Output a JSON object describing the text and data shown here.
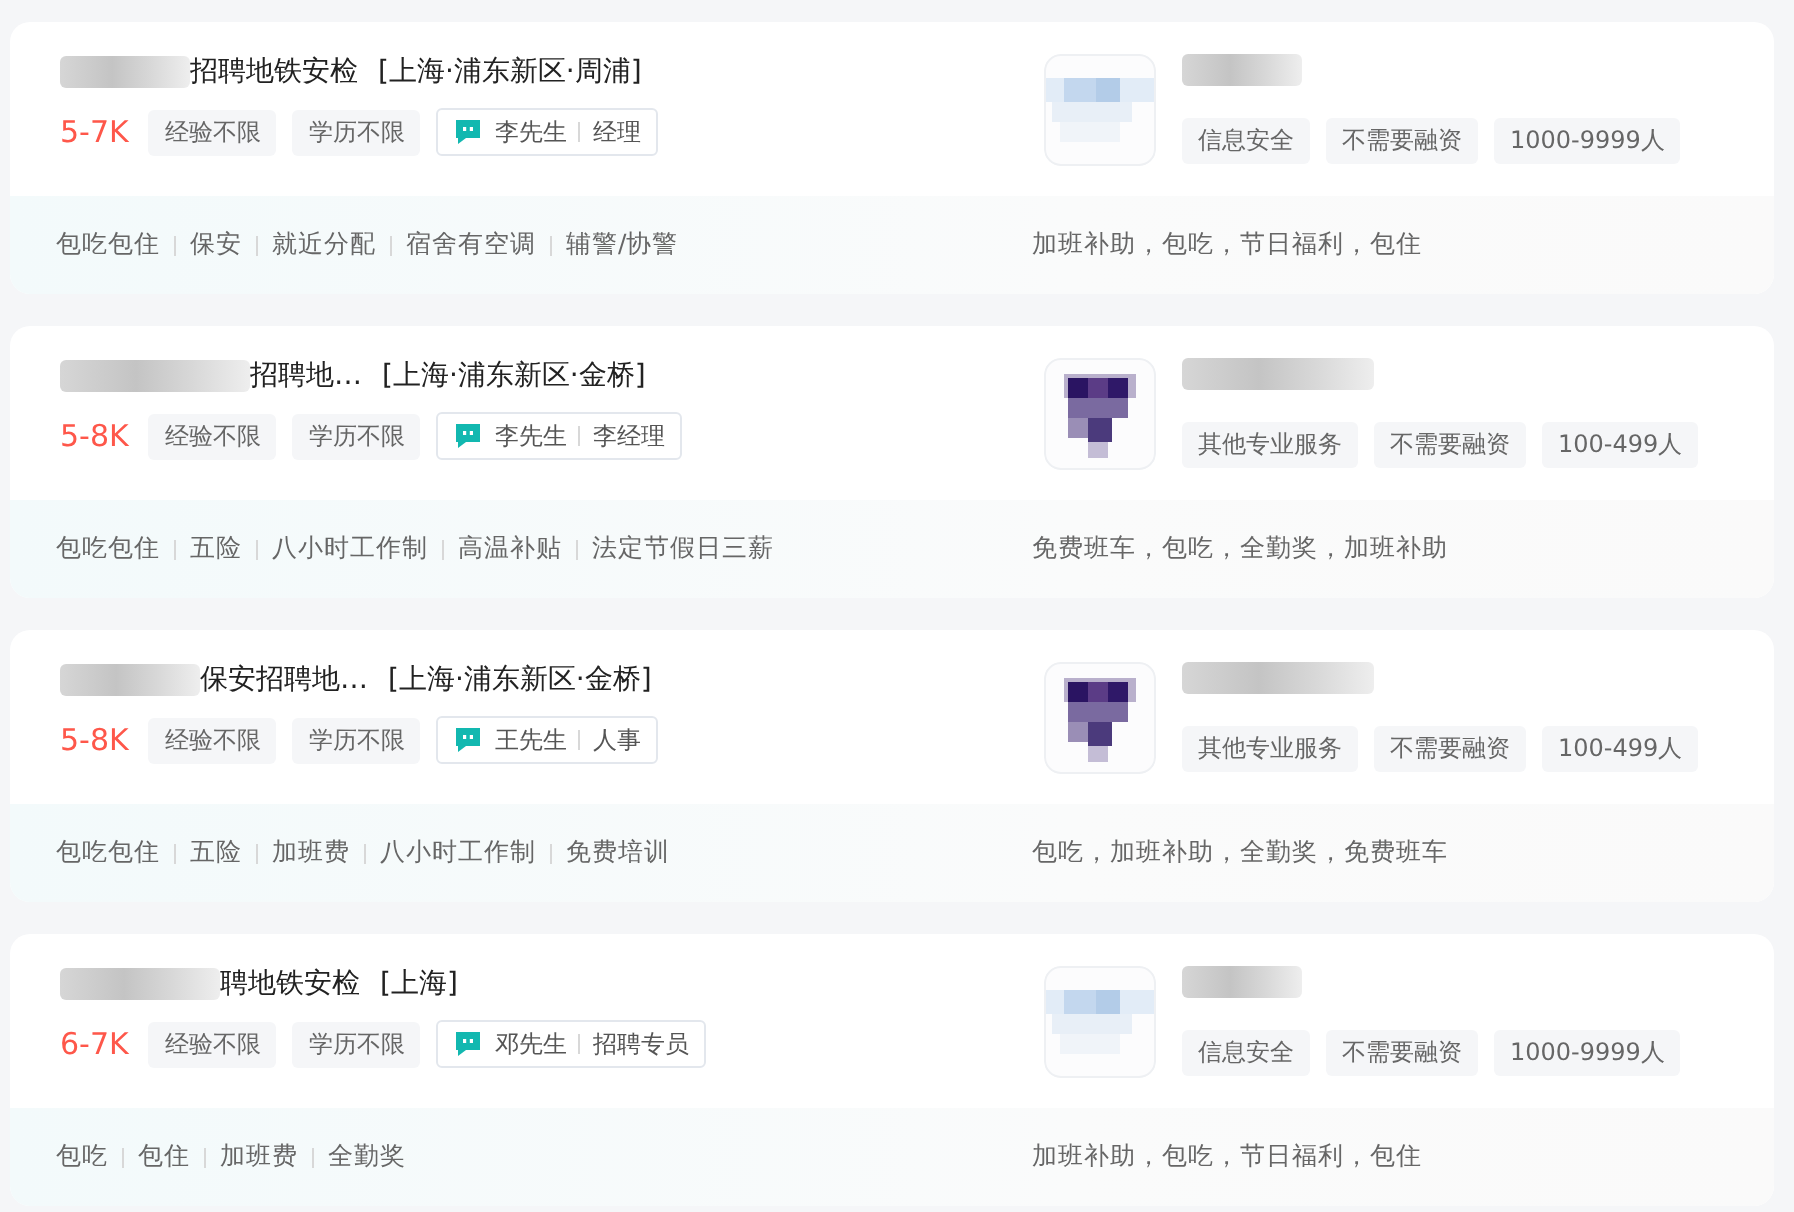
{
  "jobs": [
    {
      "title": "招聘地铁安检",
      "location": "[上海·浦东新区·周浦]",
      "salary": "5-7K",
      "requirements": [
        "经验不限",
        "学历不限"
      ],
      "recruiter": {
        "name": "李先生",
        "role": "经理"
      },
      "company_tags": [
        "信息安全",
        "不需要融资",
        "1000-9999人"
      ],
      "job_tags": [
        "包吃包住",
        "保安",
        "就近分配",
        "宿舍有空调",
        "辅警/协警"
      ],
      "benefits": "加班补助，包吃，节日福利，包住"
    },
    {
      "title": "招聘地…",
      "location": "[上海·浦东新区·金桥]",
      "salary": "5-8K",
      "requirements": [
        "经验不限",
        "学历不限"
      ],
      "recruiter": {
        "name": "李先生",
        "role": "李经理"
      },
      "company_tags": [
        "其他专业服务",
        "不需要融资",
        "100-499人"
      ],
      "job_tags": [
        "包吃包住",
        "五险",
        "八小时工作制",
        "高温补贴",
        "法定节假日三薪"
      ],
      "benefits": "免费班车，包吃，全勤奖，加班补助"
    },
    {
      "title": "保安招聘地…",
      "location": "[上海·浦东新区·金桥]",
      "salary": "5-8K",
      "requirements": [
        "经验不限",
        "学历不限"
      ],
      "recruiter": {
        "name": "王先生",
        "role": "人事"
      },
      "company_tags": [
        "其他专业服务",
        "不需要融资",
        "100-499人"
      ],
      "job_tags": [
        "包吃包住",
        "五险",
        "加班费",
        "八小时工作制",
        "免费培训"
      ],
      "benefits": "包吃，加班补助，全勤奖，免费班车"
    },
    {
      "title": "聘地铁安检",
      "location": "[上海]",
      "salary": "6-7K",
      "requirements": [
        "经验不限",
        "学历不限"
      ],
      "recruiter": {
        "name": "邓先生",
        "role": "招聘专员"
      },
      "company_tags": [
        "信息安全",
        "不需要融资",
        "1000-9999人"
      ],
      "job_tags": [
        "包吃",
        "包住",
        "加班费",
        "全勤奖"
      ],
      "benefits": "加班补助，包吃，节日福利，包住"
    }
  ]
}
